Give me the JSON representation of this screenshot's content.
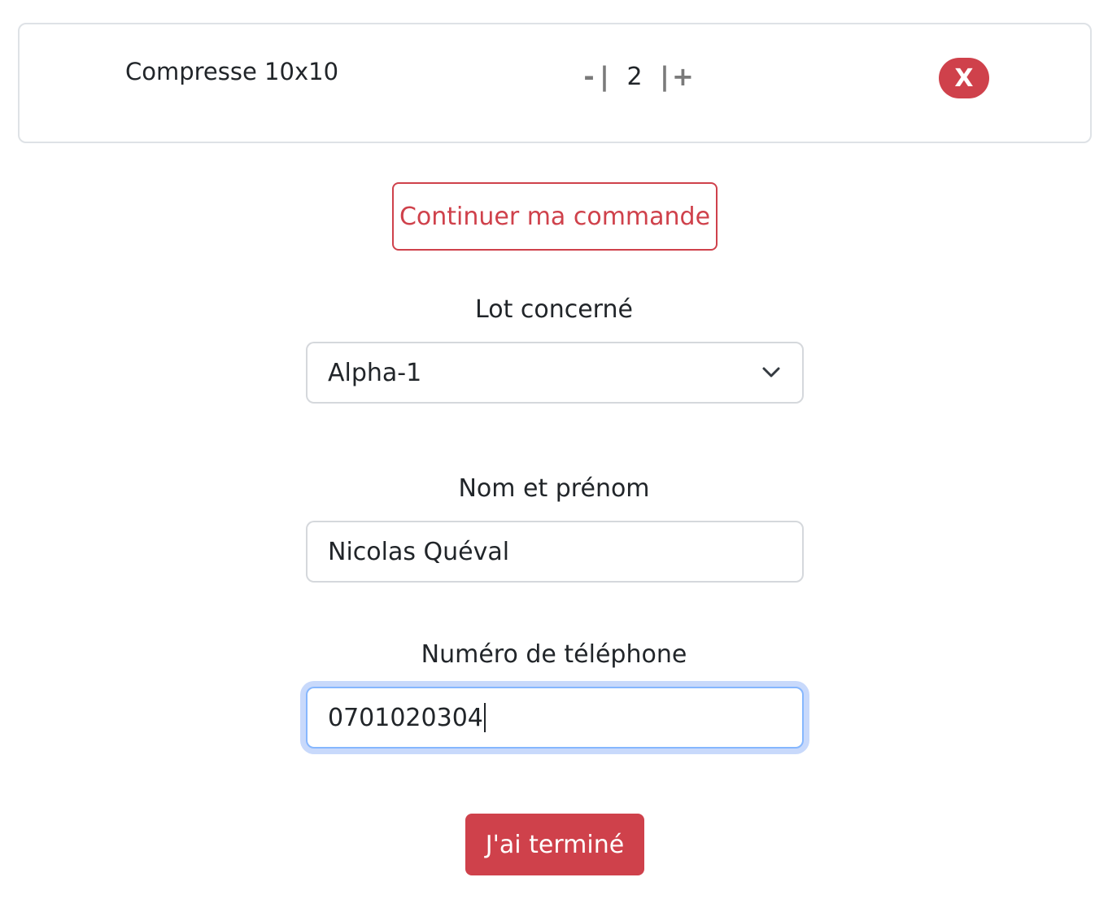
{
  "cart": {
    "item": {
      "name": "Compresse 10x10",
      "quantity": "2",
      "minus_label": "-",
      "separator": "|",
      "plus_label": "+",
      "remove_label": "X"
    }
  },
  "actions": {
    "continue_label": "Continuer ma commande",
    "submit_label": "J'ai terminé"
  },
  "form": {
    "lot": {
      "label": "Lot concerné",
      "selected": "Alpha-1",
      "icon": "chevron-down-icon"
    },
    "name": {
      "label": "Nom et prénom",
      "value": "Nicolas Quéval"
    },
    "phone": {
      "label": "Numéro de téléphone",
      "value": "0701020304"
    }
  },
  "colors": {
    "accent": "#cf414b",
    "focus_ring": "#c8d9fb",
    "focus_border": "#86b7fe"
  }
}
